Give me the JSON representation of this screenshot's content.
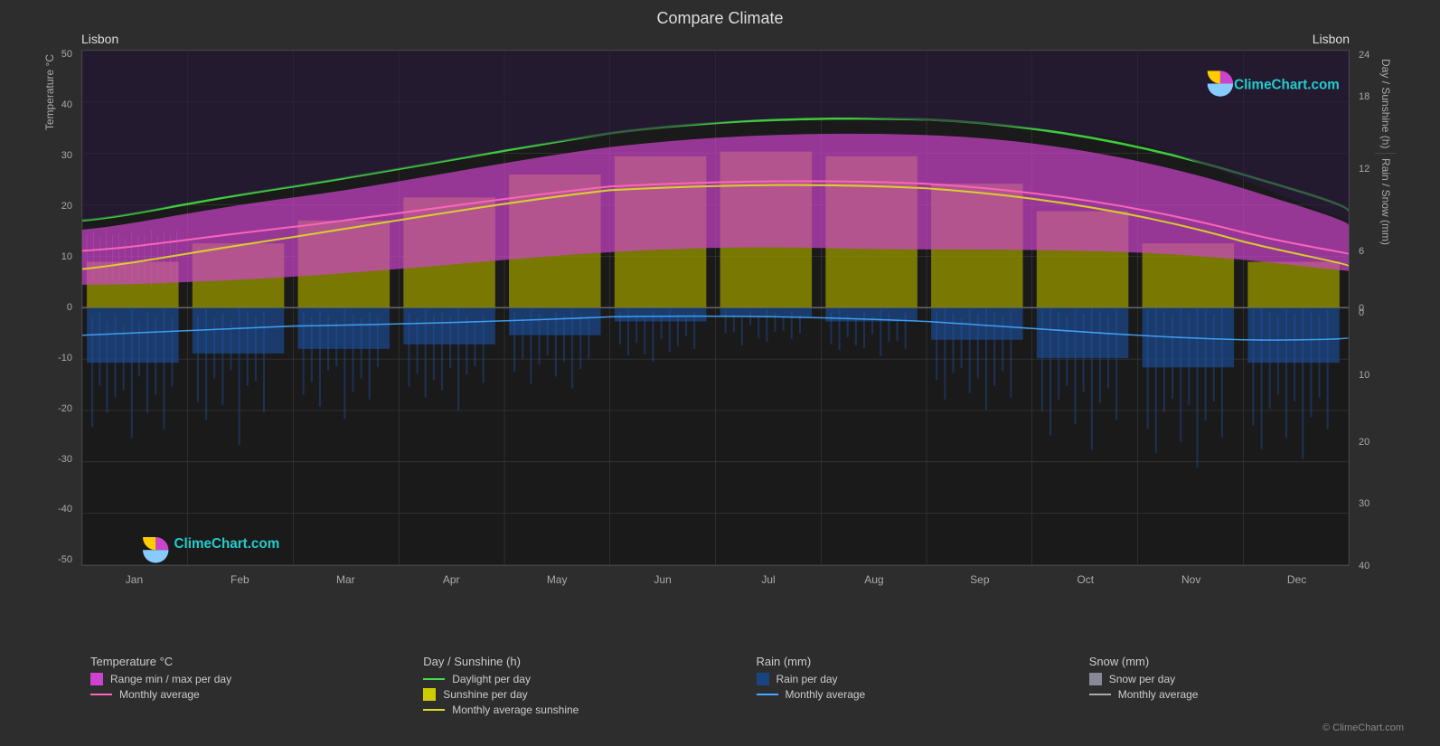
{
  "page": {
    "title": "Compare Climate",
    "location_left": "Lisbon",
    "location_right": "Lisbon",
    "logo_text": "ClimeChart.com",
    "copyright": "© ClimeChart.com"
  },
  "chart": {
    "y_left_label": "Temperature °C",
    "y_right_label_top": "Day / Sunshine (h)",
    "y_right_label_bottom": "Rain / Snow (mm)",
    "y_ticks_left": [
      "50",
      "40",
      "30",
      "20",
      "10",
      "0",
      "-10",
      "-20",
      "-30",
      "-40",
      "-50"
    ],
    "y_ticks_right_top": [
      "24",
      "18",
      "12",
      "6",
      "0"
    ],
    "y_ticks_right_bottom": [
      "0",
      "10",
      "20",
      "30",
      "40"
    ],
    "x_months": [
      "Jan",
      "Feb",
      "Mar",
      "Apr",
      "May",
      "Jun",
      "Jul",
      "Aug",
      "Sep",
      "Oct",
      "Nov",
      "Dec"
    ]
  },
  "legend": {
    "group1_title": "Temperature °C",
    "item1_1_label": "Range min / max per day",
    "item1_2_label": "Monthly average",
    "group2_title": "Day / Sunshine (h)",
    "item2_1_label": "Daylight per day",
    "item2_2_label": "Sunshine per day",
    "item2_3_label": "Monthly average sunshine",
    "group3_title": "Rain (mm)",
    "item3_1_label": "Rain per day",
    "item3_2_label": "Monthly average",
    "group4_title": "Snow (mm)",
    "item4_1_label": "Snow per day",
    "item4_2_label": "Monthly average"
  },
  "colors": {
    "temp_range": "#cc44cc",
    "temp_avg_line": "#ff66bb",
    "daylight_line": "#44dd44",
    "sunshine_bar": "#cccc00",
    "sunshine_avg_line": "#dddd00",
    "rain_bar": "#3366cc",
    "rain_avg_line": "#44aaff",
    "snow_bar": "#888899",
    "snow_avg_line": "#aaaaaa",
    "background": "#1a1a1a",
    "grid": "#444444"
  }
}
